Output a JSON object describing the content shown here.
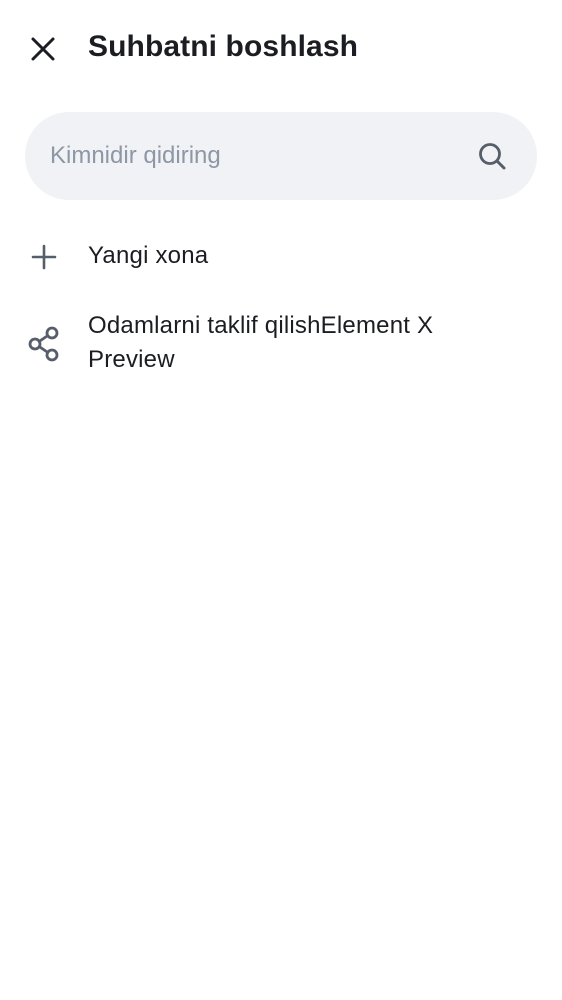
{
  "header": {
    "title": "Suhbatni boshlash",
    "close_icon": "close-icon"
  },
  "search": {
    "placeholder": "Kimnidir qidiring",
    "value": "",
    "icon": "search-icon"
  },
  "actions": [
    {
      "label": "Yangi xona",
      "icon": "plus-icon"
    },
    {
      "label": "Odamlarni taklif qilishElement X Preview",
      "icon": "share-icon"
    }
  ],
  "colors": {
    "text": "#1b1d22",
    "icon": "#565e6a",
    "placeholder": "#8d97a5",
    "search_bg": "#f0f2f5",
    "background": "#ffffff"
  }
}
